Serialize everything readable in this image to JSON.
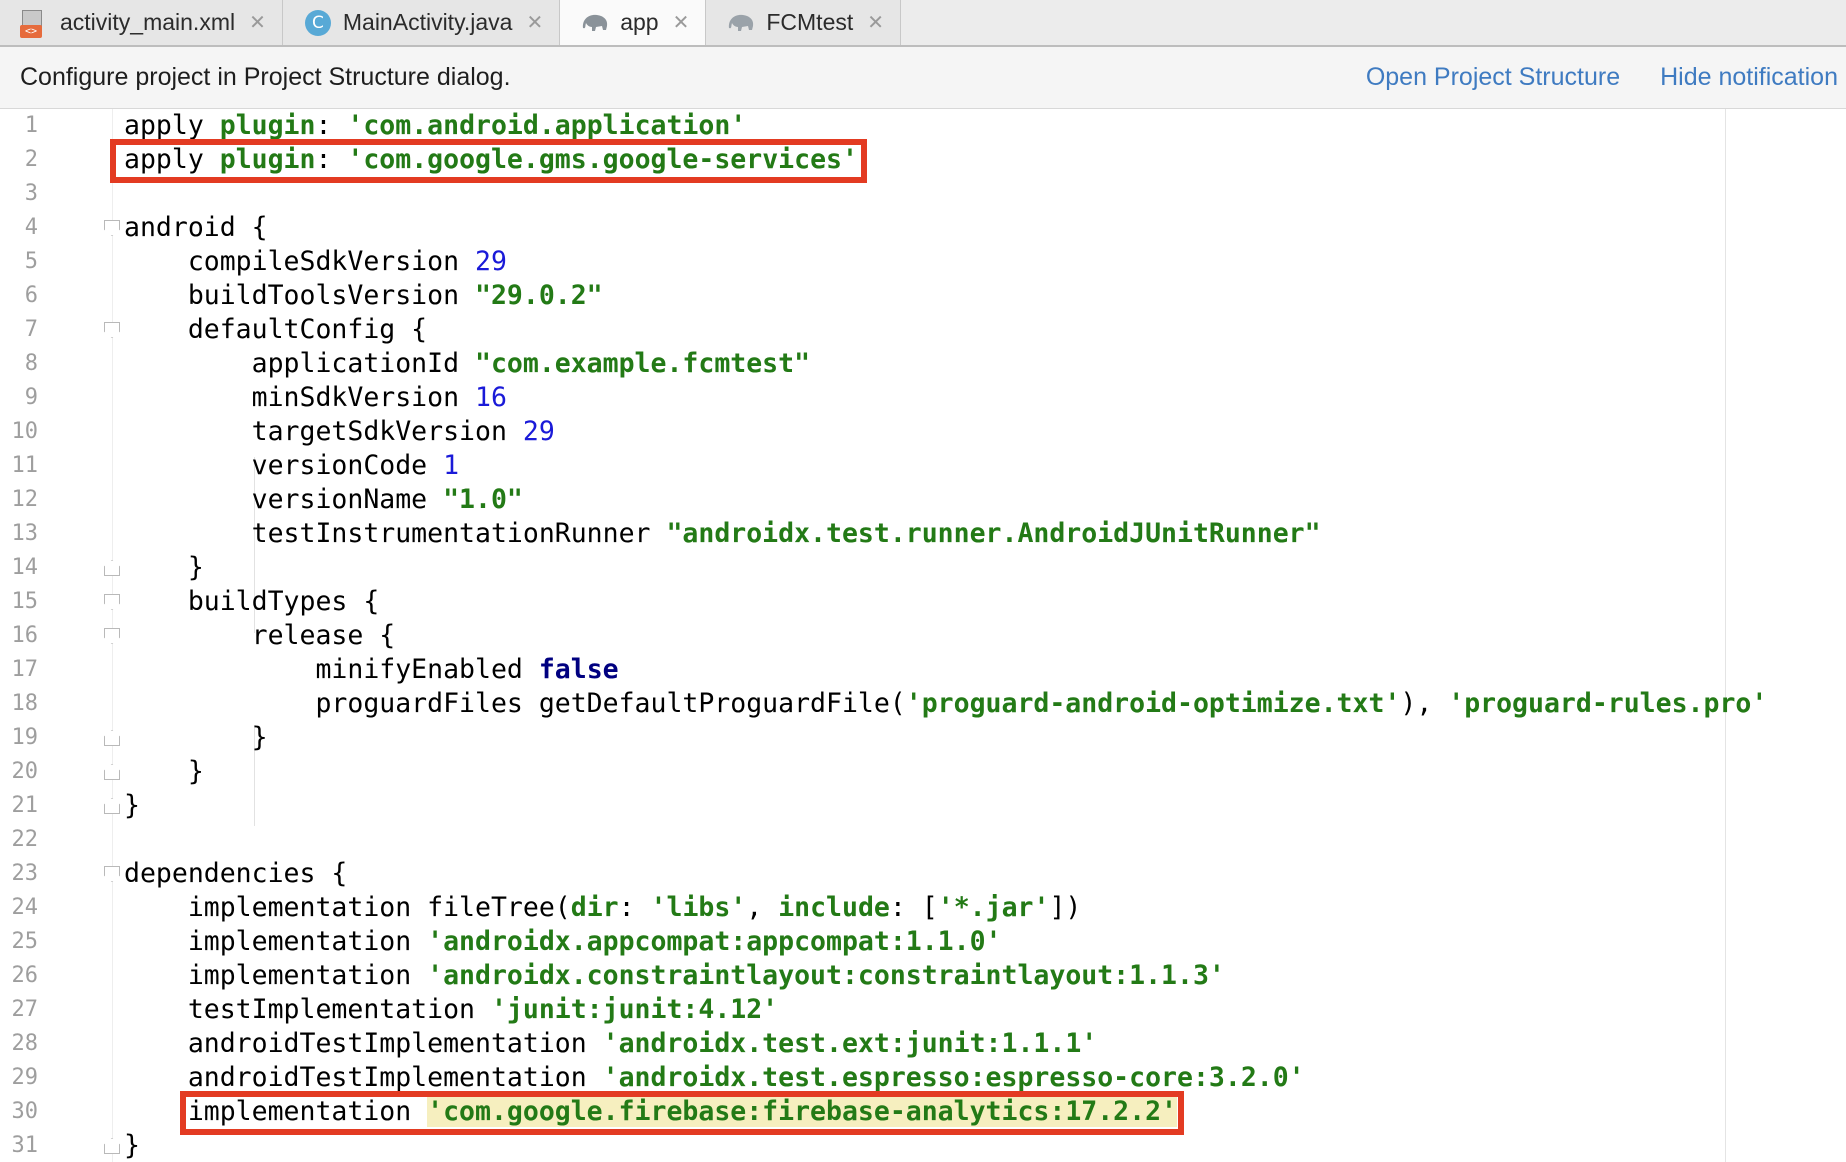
{
  "tabs": [
    {
      "label": "activity_main.xml",
      "icon": "xml-file-icon",
      "active": false
    },
    {
      "label": "MainActivity.java",
      "icon": "java-class-icon",
      "active": false
    },
    {
      "label": "app",
      "icon": "gradle-elephant-icon",
      "active": true
    },
    {
      "label": "FCMtest",
      "icon": "gradle-elephant-icon",
      "active": false
    }
  ],
  "notification": {
    "message": "Configure project in Project Structure dialog.",
    "open_link": "Open Project Structure",
    "hide_link": "Hide notification"
  },
  "editor": {
    "line_numbers": [
      "1",
      "2",
      "3",
      "4",
      "5",
      "6",
      "7",
      "8",
      "9",
      "10",
      "11",
      "12",
      "13",
      "14",
      "15",
      "16",
      "17",
      "18",
      "19",
      "20",
      "21",
      "22",
      "23",
      "24",
      "25",
      "26",
      "27",
      "28",
      "29",
      "30",
      "31"
    ],
    "lines": {
      "l1": {
        "a": "apply ",
        "b": "plugin",
        "c": ": ",
        "d": "'com.android.application'"
      },
      "l2": {
        "a": "apply ",
        "b": "plugin",
        "c": ": ",
        "d": "'com.google.gms.google-services'"
      },
      "l4": {
        "a": "android {"
      },
      "l5": {
        "a": "    compileSdkVersion ",
        "b": "29"
      },
      "l6": {
        "a": "    buildToolsVersion ",
        "b": "\"29.0.2\""
      },
      "l7": {
        "a": "    defaultConfig {"
      },
      "l8": {
        "a": "        applicationId ",
        "b": "\"com.example.fcmtest\""
      },
      "l9": {
        "a": "        minSdkVersion ",
        "b": "16"
      },
      "l10": {
        "a": "        targetSdkVersion ",
        "b": "29"
      },
      "l11": {
        "a": "        versionCode ",
        "b": "1"
      },
      "l12": {
        "a": "        versionName ",
        "b": "\"1.0\""
      },
      "l13": {
        "a": "        testInstrumentationRunner ",
        "b": "\"androidx.test.runner.AndroidJUnitRunner\""
      },
      "l14": {
        "a": "    }"
      },
      "l15": {
        "a": "    buildTypes {"
      },
      "l16": {
        "a": "        release {"
      },
      "l17": {
        "a": "            minifyEnabled ",
        "b": "false"
      },
      "l18": {
        "a": "            proguardFiles getDefaultProguardFile(",
        "b": "'proguard-android-optimize.txt'",
        "c": "), ",
        "d": "'proguard-rules.pro'"
      },
      "l19": {
        "a": "        }"
      },
      "l20": {
        "a": "    }"
      },
      "l21": {
        "a": "}"
      },
      "l23": {
        "a": "dependencies {"
      },
      "l24": {
        "a": "    implementation fileTree(",
        "b": "dir",
        "c": ": ",
        "d": "'libs'",
        "e": ", ",
        "f": "include",
        "g": ": [",
        "h": "'*.jar'",
        "i": "])"
      },
      "l25": {
        "a": "    implementation ",
        "b": "'androidx.appcompat:appcompat:1.1.0'"
      },
      "l26": {
        "a": "    implementation ",
        "b": "'androidx.constraintlayout:constraintlayout:1.1.3'"
      },
      "l27": {
        "a": "    testImplementation ",
        "b": "'junit:junit:4.12'"
      },
      "l28": {
        "a": "    androidTestImplementation ",
        "b": "'androidx.test.ext:junit:1.1.1'"
      },
      "l29": {
        "a": "    androidTestImplementation ",
        "b": "'androidx.test.espresso:espresso-core:3.2.0'"
      },
      "l30": {
        "a": "    implementation ",
        "b": "'com.google.firebase:firebase-analytics:17.2.2'"
      },
      "l31": {
        "a": "}"
      }
    }
  },
  "colors": {
    "string": "#237a16",
    "number": "#1a1ad8",
    "keyword": "#000080",
    "annotation_box": "#e33b22",
    "link": "#3f7bc1"
  }
}
